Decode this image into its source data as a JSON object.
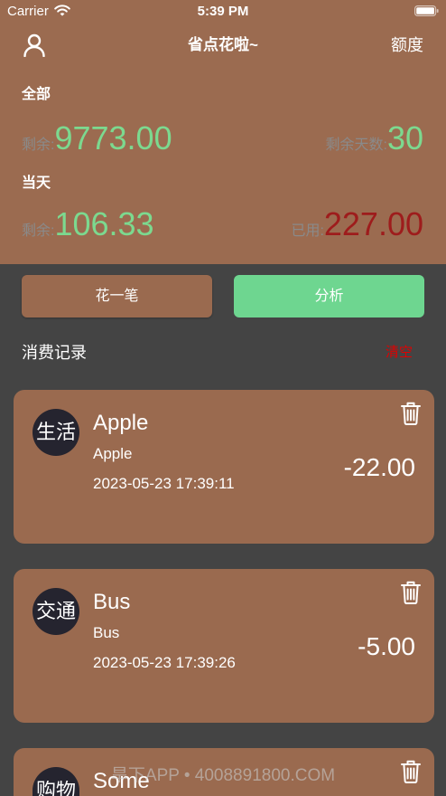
{
  "status_bar": {
    "carrier": "Carrier",
    "time": "5:39 PM"
  },
  "nav": {
    "title": "省点花啦~",
    "quota_label": "额度"
  },
  "summary": {
    "total": {
      "heading": "全部",
      "remaining_label": "剩余:",
      "remaining_value": "9773.00",
      "days_label": "剩余天数:",
      "days_value": "30"
    },
    "today": {
      "heading": "当天",
      "remaining_label": "剩余:",
      "remaining_value": "106.33",
      "used_label": "已用:",
      "used_value": "227.00"
    }
  },
  "actions": {
    "spend_label": "花一笔",
    "analyze_label": "分析"
  },
  "records": {
    "heading": "消费记录",
    "clear_label": "清空",
    "items": [
      {
        "category": "生活",
        "title": "Apple",
        "note": "Apple",
        "datetime": "2023-05-23 17:39:11",
        "amount": "-22.00"
      },
      {
        "category": "交通",
        "title": "Bus",
        "note": "Bus",
        "datetime": "2023-05-23 17:39:26",
        "amount": "-5.00"
      },
      {
        "category": "购物",
        "title": "Some"
      }
    ]
  },
  "watermark": "旱下APP • 4008891800.COM",
  "icons": {
    "status_wifi": "wifi-icon",
    "status_battery": "battery-icon",
    "profile": "user-icon",
    "delete_record": "trash-icon"
  },
  "colors": {
    "header_bg": "#9B6B50",
    "page_bg": "#444444",
    "card_bg": "#9A6A4F",
    "avatar_bg": "#25242F",
    "button_green": "#6ED690",
    "value_green": "#7CD98F",
    "used_red": "#9E1C1C",
    "clear_red": "#E00000",
    "label_gray": "#8A8A8A"
  }
}
